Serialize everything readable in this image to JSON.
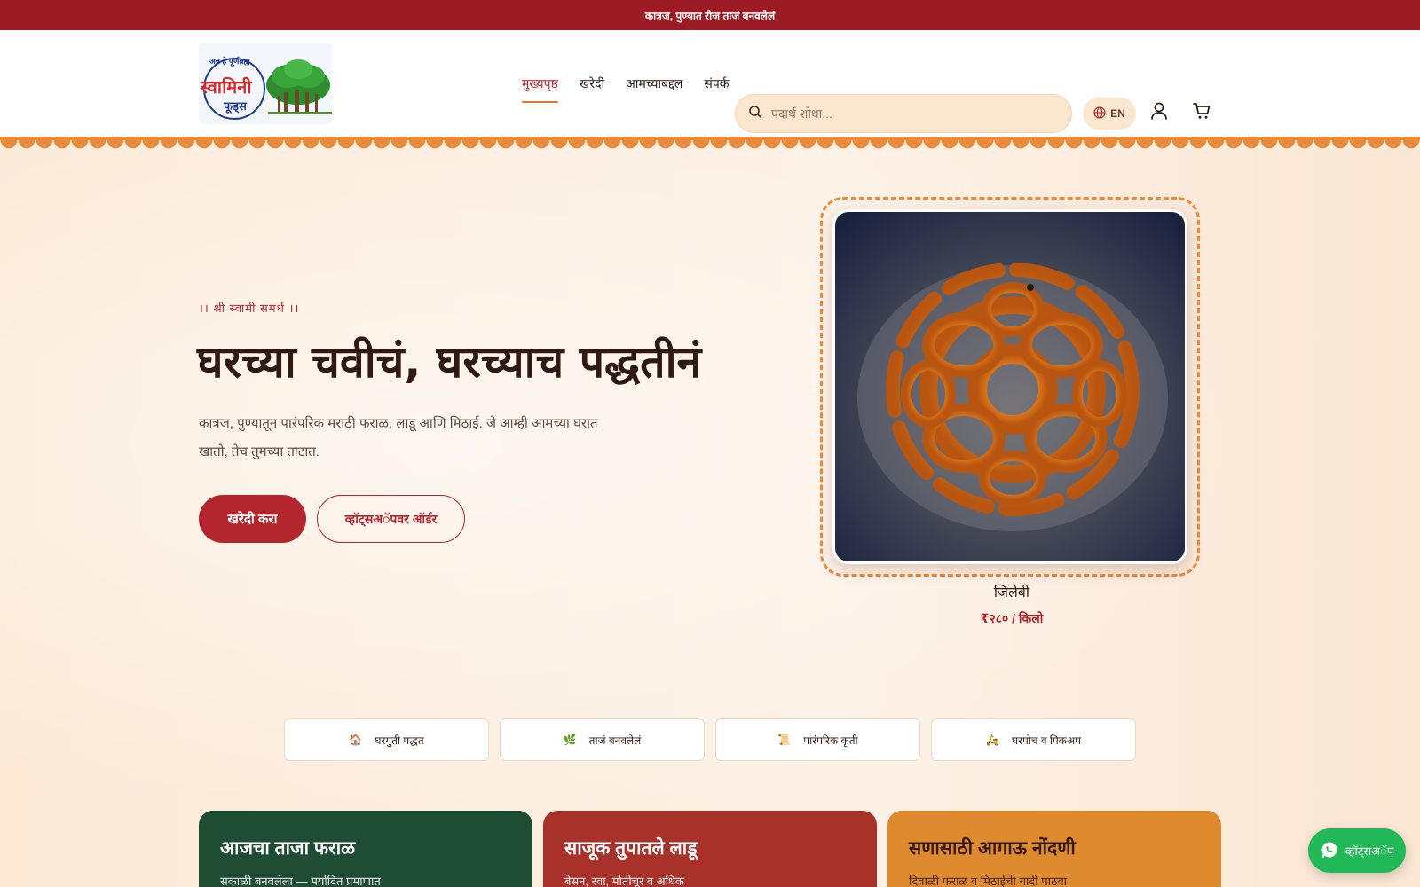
{
  "announcement": "कात्रज, पुण्यात रोज ताजं बनवलेलं",
  "brand": {
    "logo_text_top": "अन्न हे पूर्णब्रह्म",
    "logo_text_main": "स्वामिनी",
    "logo_text_sub": "फूड्स"
  },
  "nav": {
    "items": [
      {
        "label": "मुख्यपृष्ठ",
        "active": true
      },
      {
        "label": "खरेदी",
        "active": false
      },
      {
        "label": "आमच्याबद्दल",
        "active": false
      },
      {
        "label": "संपर्क",
        "active": false
      }
    ]
  },
  "search": {
    "placeholder": "पदार्थ शोधा..."
  },
  "language": {
    "label": "EN"
  },
  "hero": {
    "eyebrow": "।। श्री स्वामी समर्थ ।।",
    "headline": "घरच्या चवीचं, घरच्याच पद्धतीनं",
    "subtext": "कात्रज, पुण्यातून पारंपरिक मराठी फराळ, लाडू आणि मिठाई. जे आम्ही आमच्या घरात खातो, तेच तुमच्या ताटात.",
    "primary_button": "खरेदी करा",
    "secondary_button": "व्हॉट्सअॅपवर ऑर्डर"
  },
  "featured_product": {
    "name": "जिलेबी",
    "price": "₹२८० / किलो"
  },
  "features": [
    {
      "icon": "house-icon",
      "glyph": "🏠",
      "label": "घरगुती पद्धत"
    },
    {
      "icon": "leaf-icon",
      "glyph": "🌿",
      "label": "ताजं बनवलेलं"
    },
    {
      "icon": "scroll-icon",
      "glyph": "📜",
      "label": "पारंपरिक कृती"
    },
    {
      "icon": "scooter-icon",
      "glyph": "🛵",
      "label": "घरपोच व पिकअप"
    }
  ],
  "cards": [
    {
      "title": "आजचा ताजा फराळ",
      "subtitle": "सकाळी बनवलेला — मर्यादित प्रमाणात"
    },
    {
      "title": "साजूक तुपातले लाडू",
      "subtitle": "बेसन, रवा, मोतीचूर व अधिक"
    },
    {
      "title": "सणासाठी आगाऊ नोंदणी",
      "subtitle": "दिवाळी फराळ व मिठाईची यादी पाठवा"
    }
  ],
  "whatsapp": {
    "label": "व्हॉट्सअॅप"
  },
  "colors": {
    "topbar": "#9b1c24",
    "accent": "#b3262e",
    "orange": "#e98a3a",
    "green_card": "#1f4d34",
    "whatsapp": "#21b857"
  }
}
